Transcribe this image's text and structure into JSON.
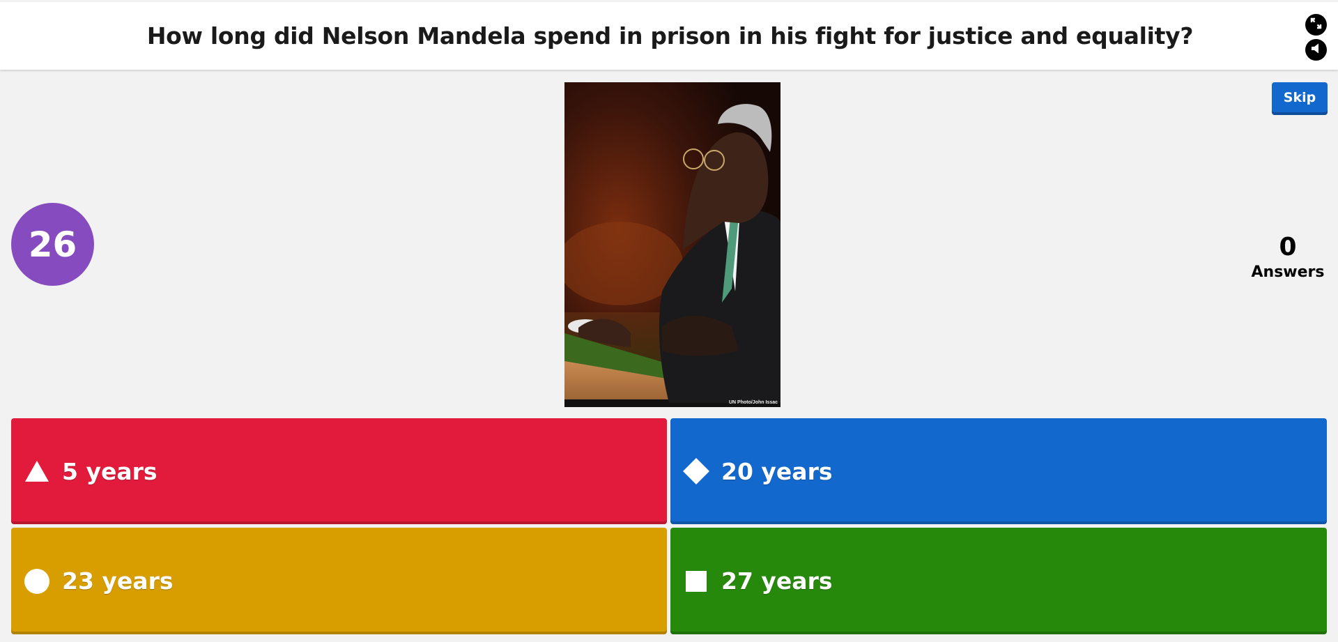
{
  "question": {
    "text": "How long did Nelson Mandela spend in prison in his fight for justice and equality?"
  },
  "controls": {
    "fullscreen_icon": "fullscreen-icon",
    "sound_icon": "speaker-icon"
  },
  "timer": {
    "value": "26",
    "color": "#864cbf"
  },
  "image": {
    "credit": "UN Photo/John Issac"
  },
  "skip": {
    "label": "Skip",
    "color": "#1368ce"
  },
  "answers_count": {
    "number": "0",
    "label": "Answers"
  },
  "answers": [
    {
      "shape": "triangle-icon",
      "text": "5 years",
      "color": "#e21b3c"
    },
    {
      "shape": "diamond-icon",
      "text": "20 years",
      "color": "#1368ce"
    },
    {
      "shape": "circle-icon",
      "text": "23 years",
      "color": "#d89e00"
    },
    {
      "shape": "square-icon",
      "text": "27 years",
      "color": "#26890c"
    }
  ]
}
